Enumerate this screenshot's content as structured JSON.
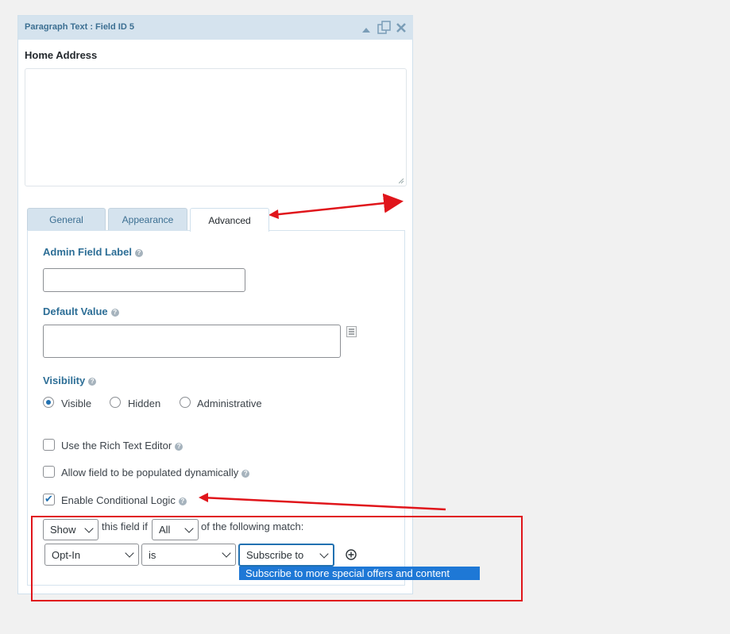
{
  "panel": {
    "title": "Paragraph Text : Field ID 5",
    "icons": [
      "collapse-icon",
      "duplicate-icon",
      "delete-icon"
    ]
  },
  "field": {
    "label": "Home Address"
  },
  "tabs": [
    {
      "label": "General"
    },
    {
      "label": "Appearance"
    },
    {
      "label": "Advanced",
      "active": true
    }
  ],
  "advanced": {
    "admin_label": {
      "label": "Admin Field Label",
      "value": ""
    },
    "default_value": {
      "label": "Default Value",
      "value": ""
    },
    "visibility": {
      "label": "Visibility",
      "options": [
        {
          "label": "Visible",
          "checked": true
        },
        {
          "label": "Hidden",
          "checked": false
        },
        {
          "label": "Administrative",
          "checked": false
        }
      ]
    },
    "checkboxes": [
      {
        "label": "Use the Rich Text Editor",
        "checked": false
      },
      {
        "label": "Allow field to be populated dynamically",
        "checked": false
      },
      {
        "label": "Enable Conditional Logic",
        "checked": true
      }
    ],
    "conditional": {
      "action": "Show",
      "text_1": "this field if",
      "match": "All",
      "text_2": "of the following match:",
      "rule": {
        "field": "Opt-In",
        "operator": "is",
        "value": "Subscribe to",
        "highlighted_option": "Subscribe to more special offers and content"
      }
    }
  },
  "colors": {
    "accent": "#2271b1",
    "annotation": "#e0151b",
    "header": "#d5e3ee"
  }
}
